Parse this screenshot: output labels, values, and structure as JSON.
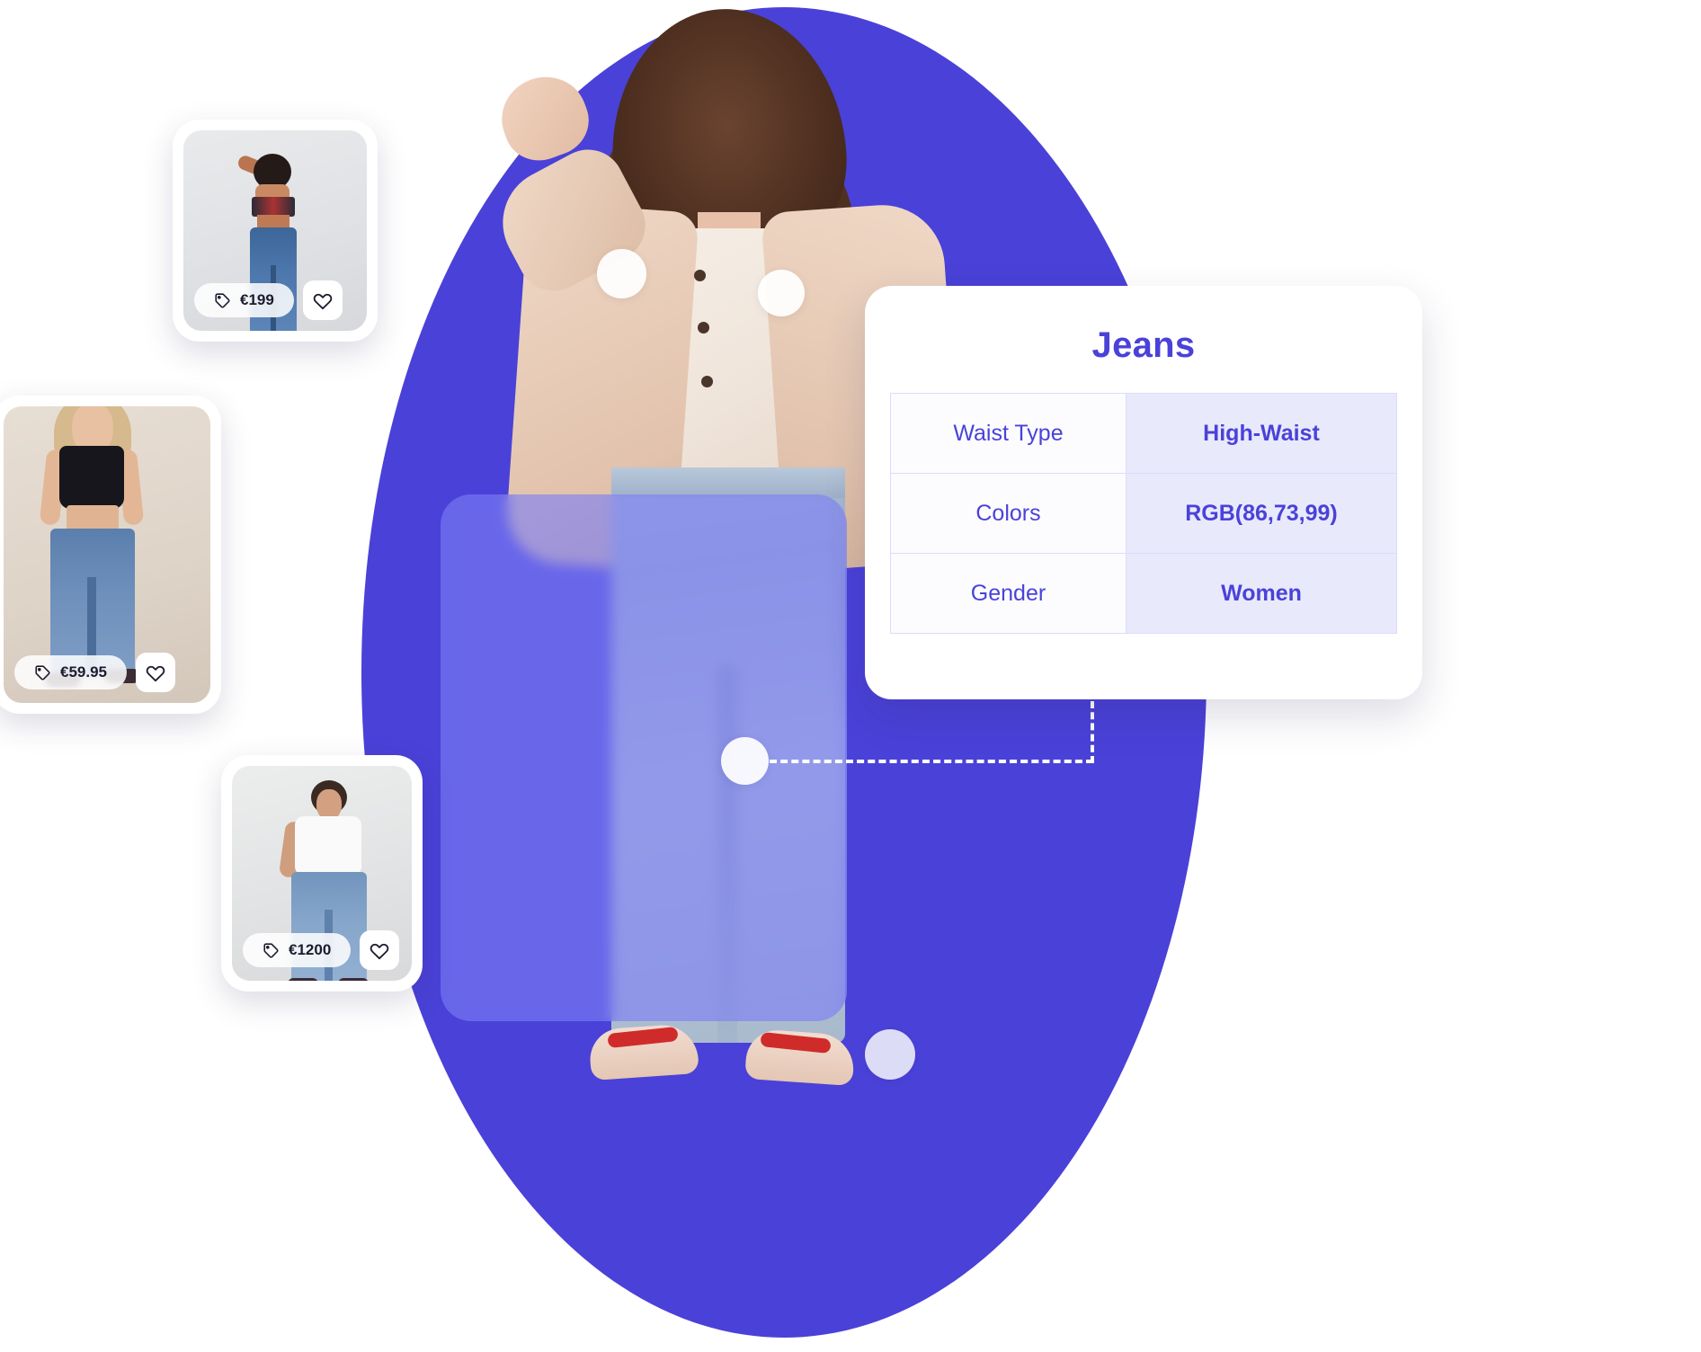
{
  "hero": {
    "alt": "Woman wearing beige jacket, white t-shirt and high-waist wide-leg jeans",
    "detection_dots": [
      "shirt-dot",
      "sleeve-dot",
      "jeans-dot",
      "shoe-dot"
    ],
    "highlight_region_label": "jeans"
  },
  "info_card": {
    "title": "Jeans",
    "rows": [
      {
        "key": "Waist Type",
        "value": "High-Waist"
      },
      {
        "key": "Colors",
        "value": "RGB(86,73,99)"
      },
      {
        "key": "Gender",
        "value": "Women"
      }
    ]
  },
  "product_cards": [
    {
      "price": "€199",
      "tag_icon": "price-tag-icon",
      "fav_icon": "heart-icon",
      "alt": "Model in blue wide-leg jeans, back view"
    },
    {
      "price": "€59.95",
      "tag_icon": "price-tag-icon",
      "fav_icon": "heart-icon",
      "alt": "Model in black crop top and blue wide-leg jeans"
    },
    {
      "price": "€1200",
      "tag_icon": "price-tag-icon",
      "fav_icon": "heart-icon",
      "alt": "Model in white t-shirt and blue wide-leg jeans"
    }
  ],
  "colors": {
    "brand_purple": "#4a41d8",
    "accent_purple": "#4a42d8",
    "highlight_overlay": "#7c7ef6",
    "table_key_bg": "#fcfcff",
    "table_value_bg": "#e9e9fc",
    "table_border": "#dcdcfb",
    "card_white": "#ffffff",
    "price_text": "#1d1b2e"
  }
}
